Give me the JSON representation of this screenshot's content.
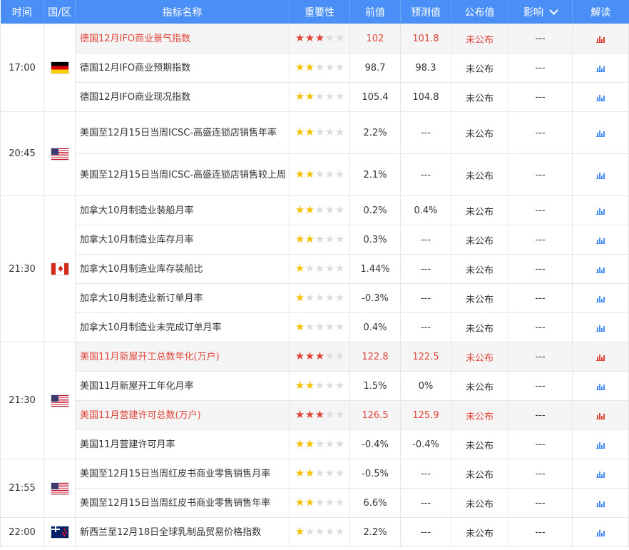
{
  "header": {
    "time": "时间",
    "region": "国/区",
    "name": "指标名称",
    "importance": "重要性",
    "previous": "前值",
    "forecast": "预测值",
    "published": "公布值",
    "impact": "影响",
    "interpret": "解读"
  },
  "groups": [
    {
      "time": "17:00",
      "flag": "de-flag-icon",
      "rows": [
        {
          "name": "德国12月IFO商业景气指数",
          "stars": 3,
          "prev": "102",
          "forecast": "101.8",
          "pub": "未公布",
          "impact": "---",
          "hi": true
        },
        {
          "name": "德国12月IFO商业预期指数",
          "stars": 2,
          "prev": "98.7",
          "forecast": "98.3",
          "pub": "未公布",
          "impact": "---",
          "hi": false
        },
        {
          "name": "德国12月IFO商业现况指数",
          "stars": 2,
          "prev": "105.4",
          "forecast": "104.8",
          "pub": "未公布",
          "impact": "---",
          "hi": false
        }
      ]
    },
    {
      "time": "20:45",
      "flag": "us-flag-icon",
      "rows": [
        {
          "name": "美国至12月15日当周ICSC-高盛连锁店销售年率",
          "stars": 2,
          "prev": "2.2%",
          "forecast": "---",
          "pub": "未公布",
          "impact": "---",
          "hi": false,
          "tall": true
        },
        {
          "name": "美国至12月15日当周ICSC-高盛连锁店销售较上周",
          "stars": 2,
          "prev": "2.1%",
          "forecast": "---",
          "pub": "未公布",
          "impact": "---",
          "hi": false,
          "tall": true
        }
      ]
    },
    {
      "time": "21:30",
      "flag": "ca-flag-icon",
      "rows": [
        {
          "name": "加拿大10月制造业装船月率",
          "stars": 2,
          "prev": "0.2%",
          "forecast": "0.4%",
          "pub": "未公布",
          "impact": "---",
          "hi": false
        },
        {
          "name": "加拿大10月制造业库存月率",
          "stars": 2,
          "prev": "0.3%",
          "forecast": "---",
          "pub": "未公布",
          "impact": "---",
          "hi": false
        },
        {
          "name": "加拿大10月制造业库存装船比",
          "stars": 1,
          "prev": "1.44%",
          "forecast": "---",
          "pub": "未公布",
          "impact": "---",
          "hi": false
        },
        {
          "name": "加拿大10月制造业新订单月率",
          "stars": 1,
          "prev": "-0.3%",
          "forecast": "---",
          "pub": "未公布",
          "impact": "---",
          "hi": false
        },
        {
          "name": "加拿大10月制造业未完成订单月率",
          "stars": 1,
          "prev": "0.4%",
          "forecast": "---",
          "pub": "未公布",
          "impact": "---",
          "hi": false
        }
      ]
    },
    {
      "time": "21:30",
      "flag": "us-flag-icon",
      "rows": [
        {
          "name": "美国11月新屋开工总数年化(万户)",
          "stars": 3,
          "prev": "122.8",
          "forecast": "122.5",
          "pub": "未公布",
          "impact": "---",
          "hi": true
        },
        {
          "name": "美国11月新屋开工年化月率",
          "stars": 2,
          "prev": "1.5%",
          "forecast": "0%",
          "pub": "未公布",
          "impact": "---",
          "hi": false
        },
        {
          "name": "美国11月营建许可总数(万户)",
          "stars": 3,
          "prev": "126.5",
          "forecast": "125.9",
          "pub": "未公布",
          "impact": "---",
          "hi": true
        },
        {
          "name": "美国11月营建许可月率",
          "stars": 2,
          "prev": "-0.4%",
          "forecast": "-0.4%",
          "pub": "未公布",
          "impact": "---",
          "hi": false
        }
      ]
    },
    {
      "time": "21:55",
      "flag": "us-flag-icon",
      "rows": [
        {
          "name": "美国至12月15日当周红皮书商业零售销售月率",
          "stars": 2,
          "prev": "-0.5%",
          "forecast": "---",
          "pub": "未公布",
          "impact": "---",
          "hi": false
        },
        {
          "name": "美国至12月15日当周红皮书商业零售销售年率",
          "stars": 2,
          "prev": "6.6%",
          "forecast": "---",
          "pub": "未公布",
          "impact": "---",
          "hi": false
        }
      ]
    },
    {
      "time": "22:00",
      "flag": "nz-flag-icon",
      "rows": [
        {
          "name": "新西兰至12月18日全球乳制品贸易价格指数",
          "stars": 1,
          "prev": "2.2%",
          "forecast": "---",
          "pub": "未公布",
          "impact": "---",
          "hi": false
        }
      ]
    }
  ],
  "colors": {
    "header_bg": "#4a8ff5",
    "highlight_text": "#e0453a",
    "star_yellow": "#f5c000",
    "star_red": "#e0453a",
    "star_empty": "#dcdcdc"
  }
}
